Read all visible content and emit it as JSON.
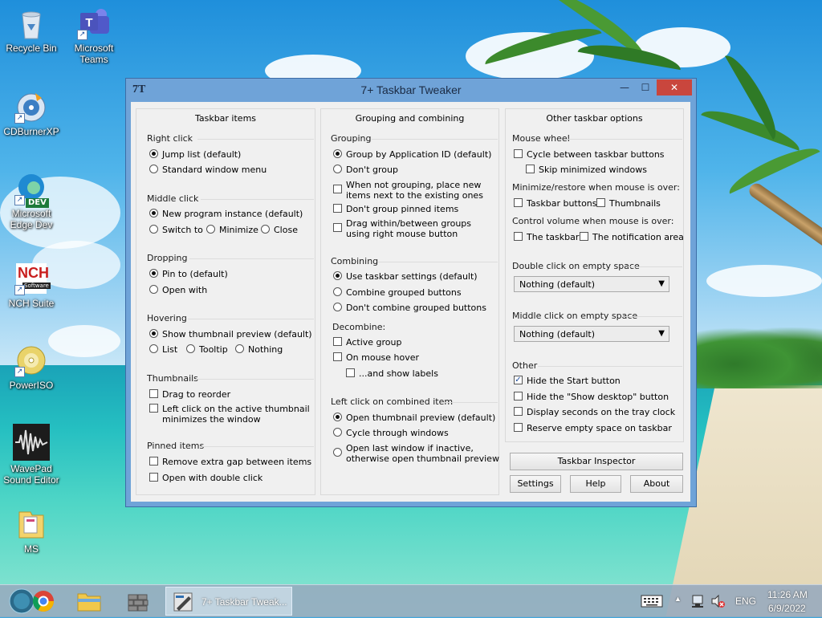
{
  "desktop": {
    "icons": [
      {
        "label": "Recycle Bin",
        "icon": "recycle-bin-icon"
      },
      {
        "label": "Microsoft Teams",
        "icon": "teams-icon"
      },
      {
        "label": "CDBurnerXP",
        "icon": "cdburnerxp-icon"
      },
      {
        "label": "Microsoft Edge Dev",
        "icon": "edge-dev-icon"
      },
      {
        "label": "NCH Suite",
        "icon": "nch-icon"
      },
      {
        "label": "PowerISO",
        "icon": "poweriso-icon"
      },
      {
        "label": "WavePad Sound Editor",
        "icon": "wavepad-icon"
      },
      {
        "label": "MS",
        "icon": "folder-icon"
      }
    ],
    "teams_line1": "Microsoft",
    "teams_line2": "Teams",
    "edge_line1": "Microsoft",
    "edge_line2": "Edge Dev",
    "wavepad_line1": "WavePad",
    "wavepad_line2": "Sound Editor",
    "edge_badge": "DEV",
    "nch_logo": "NCH",
    "nch_sub": "Software"
  },
  "window": {
    "title": "7+ Taskbar Tweaker",
    "app_icon_text": "7T",
    "minimize": "—",
    "maximize": "☐",
    "close": "✕"
  },
  "col1": {
    "header": "Taskbar items",
    "right_click": {
      "title": "Right click",
      "options": [
        "Jump list (default)",
        "Standard window menu"
      ],
      "selected": 0
    },
    "middle_click": {
      "title": "Middle click",
      "options": [
        "New program instance (default)",
        "Switch to",
        "Minimize",
        "Close"
      ],
      "selected": 0
    },
    "dropping": {
      "title": "Dropping",
      "options": [
        "Pin to (default)",
        "Open with"
      ],
      "selected": 0
    },
    "hovering": {
      "title": "Hovering",
      "options": [
        "Show thumbnail preview (default)",
        "List",
        "Tooltip",
        "Nothing"
      ],
      "selected": 0
    },
    "thumbnails": {
      "title": "Thumbnails",
      "drag": "Drag to reorder",
      "left_click_l1": "Left click on the active thumbnail",
      "left_click_l2": "minimizes the window"
    },
    "pinned": {
      "title": "Pinned items",
      "remove_gap": "Remove extra gap between items",
      "open_double": "Open with double click"
    }
  },
  "col2": {
    "header": "Grouping and combining",
    "grouping": {
      "title": "Grouping",
      "options": [
        "Group by Application ID (default)",
        "Don't group"
      ],
      "selected": 0,
      "place_new_l1": "When not grouping, place new",
      "place_new_l2": "items next to the existing ones",
      "dont_group_pinned": "Don't group pinned items",
      "drag_l1": "Drag within/between groups",
      "drag_l2": "using right mouse button"
    },
    "combining": {
      "title": "Combining",
      "options": [
        "Use taskbar settings (default)",
        "Combine grouped buttons",
        "Don't combine grouped buttons"
      ],
      "selected": 0
    },
    "decombine": {
      "title": "Decombine:",
      "active_group": "Active group",
      "on_hover": "On mouse hover",
      "show_labels": "...and show labels"
    },
    "left_click": {
      "title": "Left click on combined item",
      "options": [
        "Open thumbnail preview (default)",
        "Cycle through windows"
      ],
      "selected": 0,
      "open_last_l1": "Open last window if inactive,",
      "open_last_l2": "otherwise open thumbnail preview"
    }
  },
  "col3": {
    "header": "Other taskbar options",
    "mouse_wheel": {
      "title": "Mouse wheel",
      "cycle": "Cycle between taskbar buttons",
      "skip_min": "Skip minimized windows"
    },
    "minimize_restore": {
      "title": "Minimize/restore when mouse is over:",
      "taskbar_buttons": "Taskbar buttons",
      "thumbnails": "Thumbnails"
    },
    "volume": {
      "title": "Control volume when mouse is over:",
      "taskbar": "The taskbar",
      "notification": "The notification area"
    },
    "double_click": {
      "title": "Double click on empty space",
      "value": "Nothing (default)"
    },
    "middle_click": {
      "title": "Middle click on empty space",
      "value": "Nothing (default)"
    },
    "other": {
      "title": "Other",
      "hide_start": "Hide the Start button",
      "hide_start_checked": true,
      "hide_show_desktop": "Hide the \"Show desktop\" button",
      "display_seconds": "Display seconds on the tray clock",
      "reserve_space": "Reserve empty space on taskbar"
    },
    "inspector_button": "Taskbar Inspector",
    "settings_button": "Settings",
    "help_button": "Help",
    "about_button": "About"
  },
  "taskbar": {
    "active_label": "7+ Taskbar Tweak...",
    "lang": "ENG",
    "time": "11:26 AM",
    "date": "6/9/2022",
    "tray_up": "▲"
  },
  "colors": {
    "accent": "#6fa3d8",
    "close": "#c9463d",
    "check": "#1a4a9c"
  }
}
